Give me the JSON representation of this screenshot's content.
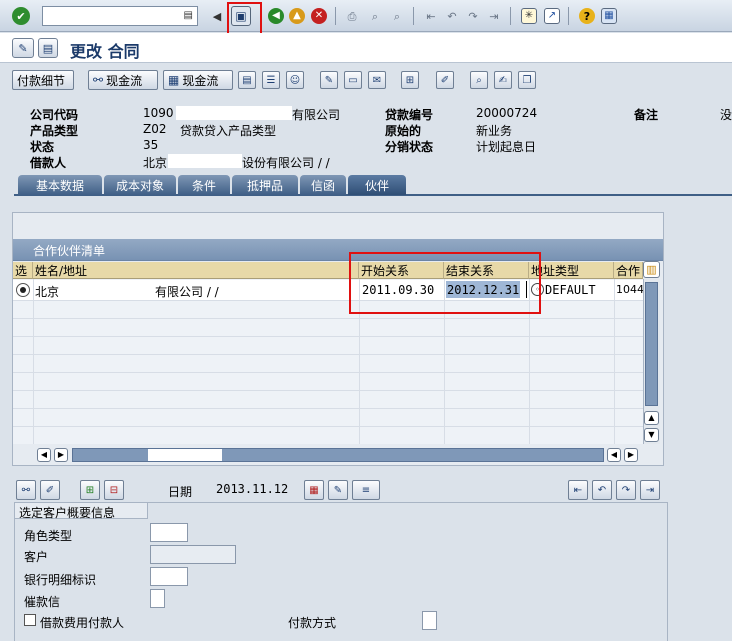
{
  "toolbar": {
    "command_value": "",
    "icons": [
      "enter-icon",
      "save-icon",
      "back-icon",
      "exit-icon",
      "cancel-icon",
      "print-icon",
      "find-icon",
      "find-next-icon",
      "first-page-icon",
      "prev-page-icon",
      "next-page-icon",
      "last-page-icon",
      "new-session-icon",
      "shortcut-icon",
      "help-icon",
      "layout-icon"
    ]
  },
  "title": {
    "text": "更改 合同"
  },
  "app_toolbar": {
    "btn_payment_detail": "付款细节",
    "btn_cashflow1": "现金流",
    "btn_cashflow2": "现金流"
  },
  "header": {
    "company_code_label": "公司代码",
    "company_code": "1090",
    "company_name": "有限公司",
    "product_type_label": "产品类型",
    "product_type": "Z02",
    "product_type_desc": "贷款贷入产品类型",
    "status_label": "状态",
    "status": "35",
    "borrower_label": "借款人",
    "borrower_city": "北京",
    "borrower_suffix": "设份有限公司 / /",
    "loan_no_label": "贷款编号",
    "loan_no": "20000724",
    "origin_label": "原始的",
    "origin": "新业务",
    "dist_status_label": "分销状态",
    "dist_status": "计划起息日",
    "note_label": "备注",
    "note_value": "没"
  },
  "tabs": [
    {
      "label": "基本数据"
    },
    {
      "label": "成本对象"
    },
    {
      "label": "条件"
    },
    {
      "label": "抵押品"
    },
    {
      "label": "信函"
    },
    {
      "label": "伙伴"
    }
  ],
  "partner_table": {
    "title": "合作伙伴清单",
    "columns": {
      "sel": "选",
      "name": "姓名/地址",
      "start": "开始关系",
      "end": "结束关系",
      "addr_type": "地址类型",
      "partner": "合作"
    },
    "rows": [
      {
        "city": "北京",
        "name_suffix": "有限公司 / /",
        "start": "2011.09.30",
        "end": "2012.12.31",
        "addr_type": "DEFAULT",
        "partner": "1044"
      }
    ]
  },
  "bottom": {
    "date_label": "日期",
    "date_value": "2013.11.12",
    "section_title": "选定客户概要信息",
    "role_type_label": "角色类型",
    "customer_label": "客户",
    "bank_detail_label": "银行明细标识",
    "dunning_label": "催款信",
    "fee_payer_label": "借款费用付款人",
    "payment_method_label": "付款方式"
  },
  "colors": {
    "highlight": "#e01010",
    "header_yellow": "#e7d9a8",
    "tab_blue": "#3f5f86"
  }
}
